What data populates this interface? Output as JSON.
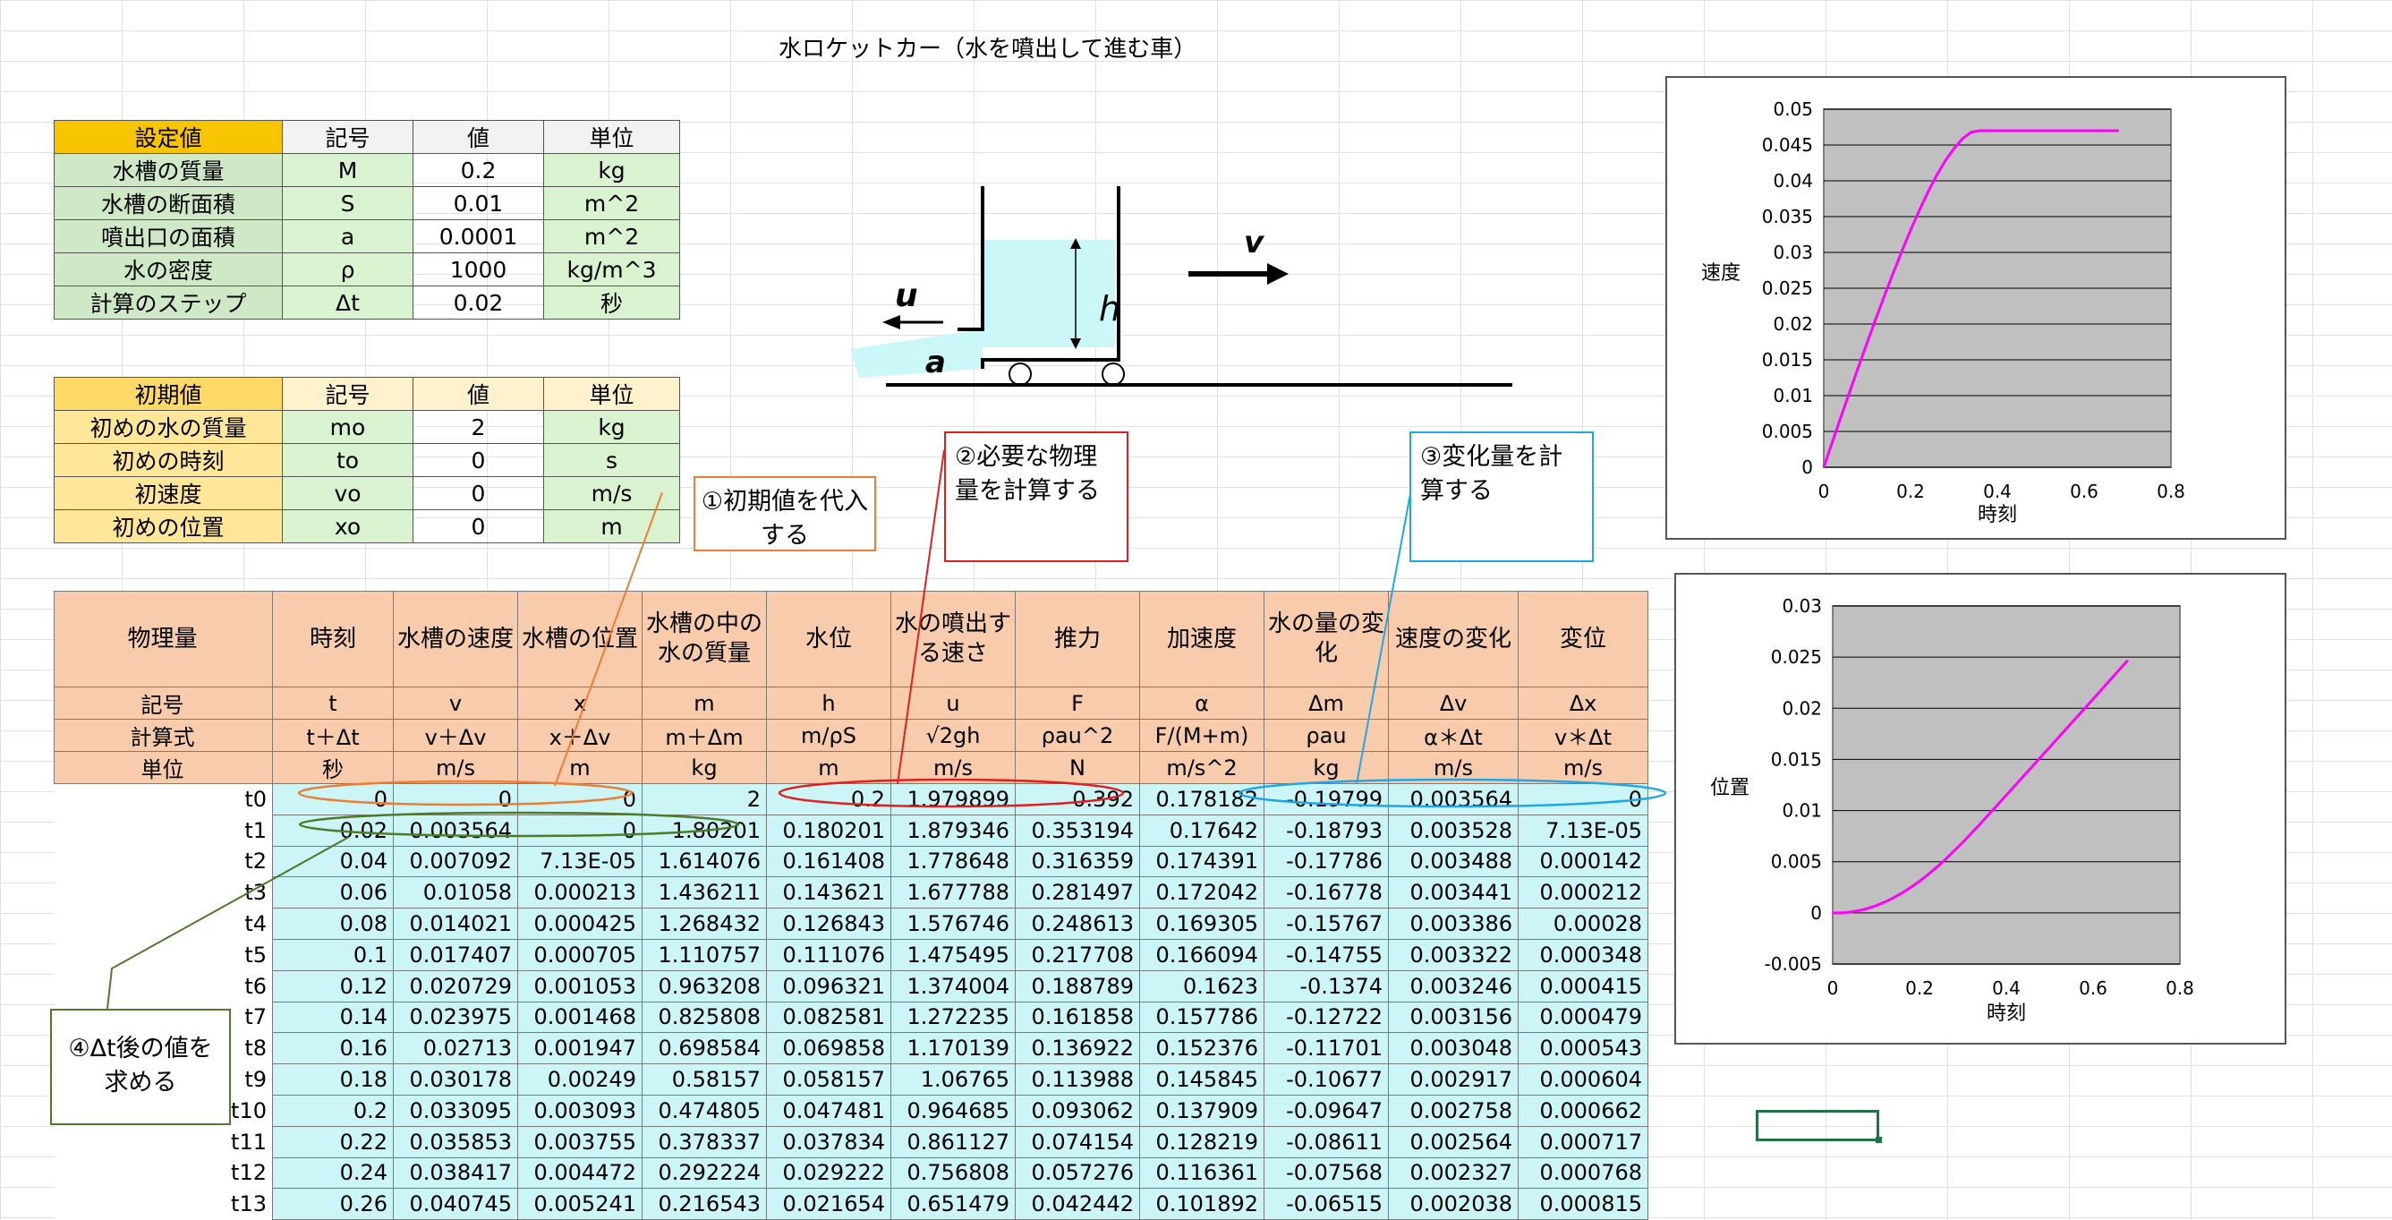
{
  "title": "水ロケットカー（水を噴出して進む車）",
  "settings": {
    "header": [
      "設定値",
      "記号",
      "値",
      "単位"
    ],
    "rows": [
      [
        "水槽の質量",
        "M",
        "0.2",
        "kg"
      ],
      [
        "水槽の断面積",
        "S",
        "0.01",
        "m^2"
      ],
      [
        "噴出口の面積",
        "a",
        "0.0001",
        "m^2"
      ],
      [
        "水の密度",
        "ρ",
        "1000",
        "kg/m^3"
      ],
      [
        "計算のステップ",
        "Δt",
        "0.02",
        "秒"
      ]
    ]
  },
  "initial": {
    "header": [
      "初期値",
      "記号",
      "値",
      "単位"
    ],
    "rows": [
      [
        "初めの水の質量",
        "mo",
        "2",
        "kg"
      ],
      [
        "初めの時刻",
        "to",
        "0",
        "s"
      ],
      [
        "初速度",
        "vo",
        "0",
        "m/s"
      ],
      [
        "初めの位置",
        "xo",
        "0",
        "m"
      ]
    ]
  },
  "diagram": {
    "u": "u",
    "h": "h",
    "v": "v",
    "a": "a"
  },
  "callouts": {
    "c1": "①初期値を代入する",
    "c2": "②必要な物理量を計算する",
    "c3": "③変化量を計算する",
    "c4": "④Δt後の値を求める"
  },
  "calc": {
    "headers": [
      "物理量",
      "時刻",
      "水槽の速度",
      "水槽の位置",
      "水槽の中の水の質量",
      "水位",
      "水の噴出する速さ",
      "推力",
      "加速度",
      "水の量の変化",
      "速度の変化",
      "変位"
    ],
    "symbols": [
      "記号",
      "t",
      "v",
      "x",
      "m",
      "h",
      "u",
      "F",
      "α",
      "Δm",
      "Δv",
      "Δx"
    ],
    "formulas": [
      "計算式",
      "t＋Δt",
      "v＋Δv",
      "x＋Δv",
      "m＋Δm",
      "m/ρS",
      "√2gh",
      "ρau^2",
      "F/(M+m)",
      "ρau",
      "α＊Δt",
      "v＊Δt"
    ],
    "units": [
      "単位",
      "秒",
      "m/s",
      "m",
      "kg",
      "m",
      "m/s",
      "N",
      "m/s^2",
      "kg",
      "m/s",
      "m/s"
    ],
    "rows": [
      [
        "t0",
        "0",
        "0",
        "0",
        "2",
        "0.2",
        "1.979899",
        "0.392",
        "0.178182",
        "-0.19799",
        "0.003564",
        "0"
      ],
      [
        "t1",
        "0.02",
        "0.003564",
        "0",
        "1.80201",
        "0.180201",
        "1.879346",
        "0.353194",
        "0.17642",
        "-0.18793",
        "0.003528",
        "7.13E-05"
      ],
      [
        "t2",
        "0.04",
        "0.007092",
        "7.13E-05",
        "1.614076",
        "0.161408",
        "1.778648",
        "0.316359",
        "0.174391",
        "-0.17786",
        "0.003488",
        "0.000142"
      ],
      [
        "t3",
        "0.06",
        "0.01058",
        "0.000213",
        "1.436211",
        "0.143621",
        "1.677788",
        "0.281497",
        "0.172042",
        "-0.16778",
        "0.003441",
        "0.000212"
      ],
      [
        "t4",
        "0.08",
        "0.014021",
        "0.000425",
        "1.268432",
        "0.126843",
        "1.576746",
        "0.248613",
        "0.169305",
        "-0.15767",
        "0.003386",
        "0.00028"
      ],
      [
        "t5",
        "0.1",
        "0.017407",
        "0.000705",
        "1.110757",
        "0.111076",
        "1.475495",
        "0.217708",
        "0.166094",
        "-0.14755",
        "0.003322",
        "0.000348"
      ],
      [
        "t6",
        "0.12",
        "0.020729",
        "0.001053",
        "0.963208",
        "0.096321",
        "1.374004",
        "0.188789",
        "0.1623",
        "-0.1374",
        "0.003246",
        "0.000415"
      ],
      [
        "t7",
        "0.14",
        "0.023975",
        "0.001468",
        "0.825808",
        "0.082581",
        "1.272235",
        "0.161858",
        "0.157786",
        "-0.12722",
        "0.003156",
        "0.000479"
      ],
      [
        "t8",
        "0.16",
        "0.02713",
        "0.001947",
        "0.698584",
        "0.069858",
        "1.170139",
        "0.136922",
        "0.152376",
        "-0.11701",
        "0.003048",
        "0.000543"
      ],
      [
        "t9",
        "0.18",
        "0.030178",
        "0.00249",
        "0.58157",
        "0.058157",
        "1.06765",
        "0.113988",
        "0.145845",
        "-0.10677",
        "0.002917",
        "0.000604"
      ],
      [
        "t10",
        "0.2",
        "0.033095",
        "0.003093",
        "0.474805",
        "0.047481",
        "0.964685",
        "0.093062",
        "0.137909",
        "-0.09647",
        "0.002758",
        "0.000662"
      ],
      [
        "t11",
        "0.22",
        "0.035853",
        "0.003755",
        "0.378337",
        "0.037834",
        "0.861127",
        "0.074154",
        "0.128219",
        "-0.08611",
        "0.002564",
        "0.000717"
      ],
      [
        "t12",
        "0.24",
        "0.038417",
        "0.004472",
        "0.292224",
        "0.029222",
        "0.756808",
        "0.057276",
        "0.116361",
        "-0.07568",
        "0.002327",
        "0.000768"
      ],
      [
        "t13",
        "0.26",
        "0.040745",
        "0.005241",
        "0.216543",
        "0.021654",
        "0.651479",
        "0.042442",
        "0.101892",
        "-0.06515",
        "0.002038",
        "0.000815"
      ]
    ]
  },
  "chart_data": [
    {
      "type": "line",
      "title": "",
      "xlabel": "時刻",
      "ylabel": "速度",
      "xlim": [
        0,
        0.8
      ],
      "ylim": [
        0,
        0.05
      ],
      "xticks": [
        "0",
        "0.2",
        "0.4",
        "0.6",
        "0.8"
      ],
      "yticks": [
        "0",
        "0.005",
        "0.01",
        "0.015",
        "0.02",
        "0.025",
        "0.03",
        "0.035",
        "0.04",
        "0.045",
        "0.05"
      ],
      "grid": true,
      "color": "#ff00ff",
      "x": [
        0,
        0.02,
        0.04,
        0.06,
        0.08,
        0.1,
        0.12,
        0.14,
        0.16,
        0.18,
        0.2,
        0.22,
        0.24,
        0.26,
        0.28,
        0.3,
        0.32,
        0.34,
        0.36,
        0.4,
        0.5,
        0.6,
        0.68
      ],
      "y": [
        0,
        0.003564,
        0.007092,
        0.01058,
        0.014021,
        0.017407,
        0.020729,
        0.023975,
        0.02713,
        0.030178,
        0.033095,
        0.035853,
        0.038417,
        0.040745,
        0.0428,
        0.0445,
        0.0459,
        0.0468,
        0.047,
        0.047,
        0.047,
        0.047,
        0.047
      ]
    },
    {
      "type": "line",
      "title": "",
      "xlabel": "時刻",
      "ylabel": "位置",
      "xlim": [
        0,
        0.8
      ],
      "ylim": [
        -0.005,
        0.03
      ],
      "xticks": [
        "0",
        "0.2",
        "0.4",
        "0.6",
        "0.8"
      ],
      "yticks": [
        "-0.005",
        "0",
        "0.005",
        "0.01",
        "0.015",
        "0.02",
        "0.025",
        "0.03"
      ],
      "grid": true,
      "color": "#ff00ff",
      "x": [
        0,
        0.02,
        0.04,
        0.06,
        0.08,
        0.1,
        0.12,
        0.14,
        0.16,
        0.18,
        0.2,
        0.22,
        0.24,
        0.26,
        0.3,
        0.34,
        0.4,
        0.5,
        0.6,
        0.68
      ],
      "y": [
        0,
        0,
        7.13e-05,
        0.000213,
        0.000425,
        0.000705,
        0.001053,
        0.001468,
        0.001947,
        0.00249,
        0.003093,
        0.003755,
        0.004472,
        0.005241,
        0.0069,
        0.0087,
        0.0115,
        0.0162,
        0.0209,
        0.0247
      ]
    }
  ]
}
